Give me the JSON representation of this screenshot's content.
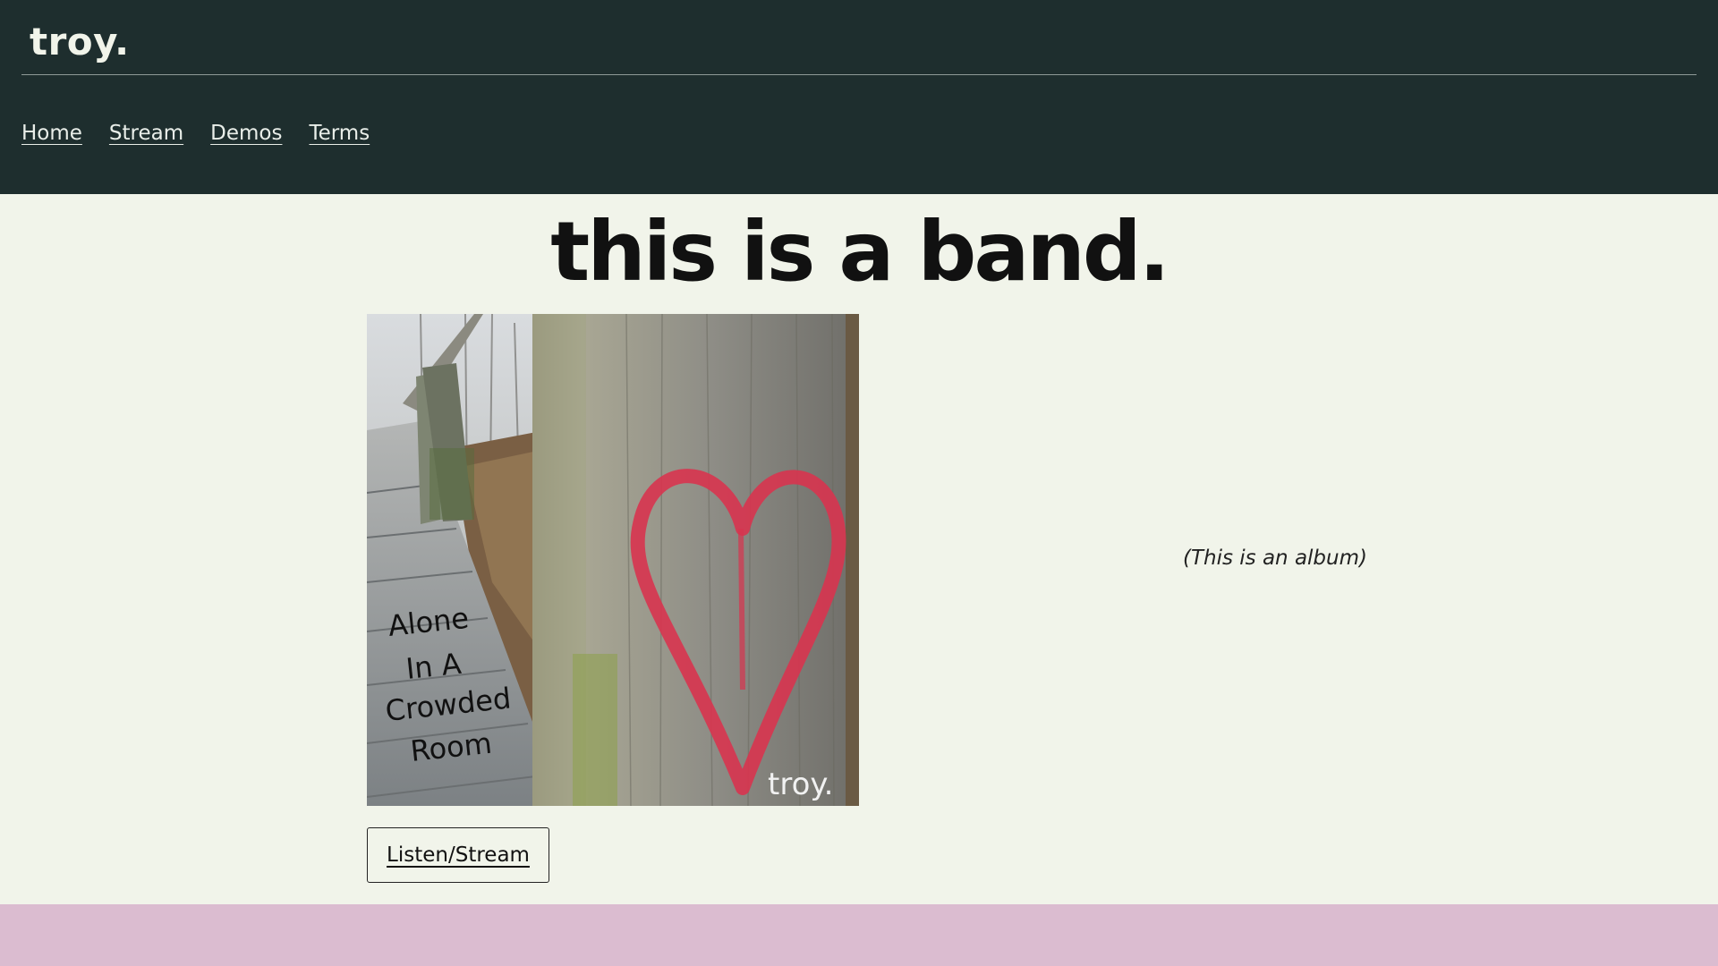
{
  "header": {
    "brand": "troy.",
    "nav": [
      {
        "label": "Home"
      },
      {
        "label": "Stream"
      },
      {
        "label": "Demos"
      },
      {
        "label": "Terms"
      }
    ]
  },
  "main": {
    "headline": "this is a band.",
    "album": {
      "cover_text": [
        "Alone",
        "In A",
        "Crowded",
        "Room"
      ],
      "cover_watermark": "troy.",
      "caption": "(This is an album)"
    },
    "listen_button": "Listen/Stream"
  },
  "colors": {
    "header_bg": "#1e2e2e",
    "page_bg": "#f1f4ea",
    "footer_band": "#dbbcd0",
    "heart": "#d8344f"
  }
}
